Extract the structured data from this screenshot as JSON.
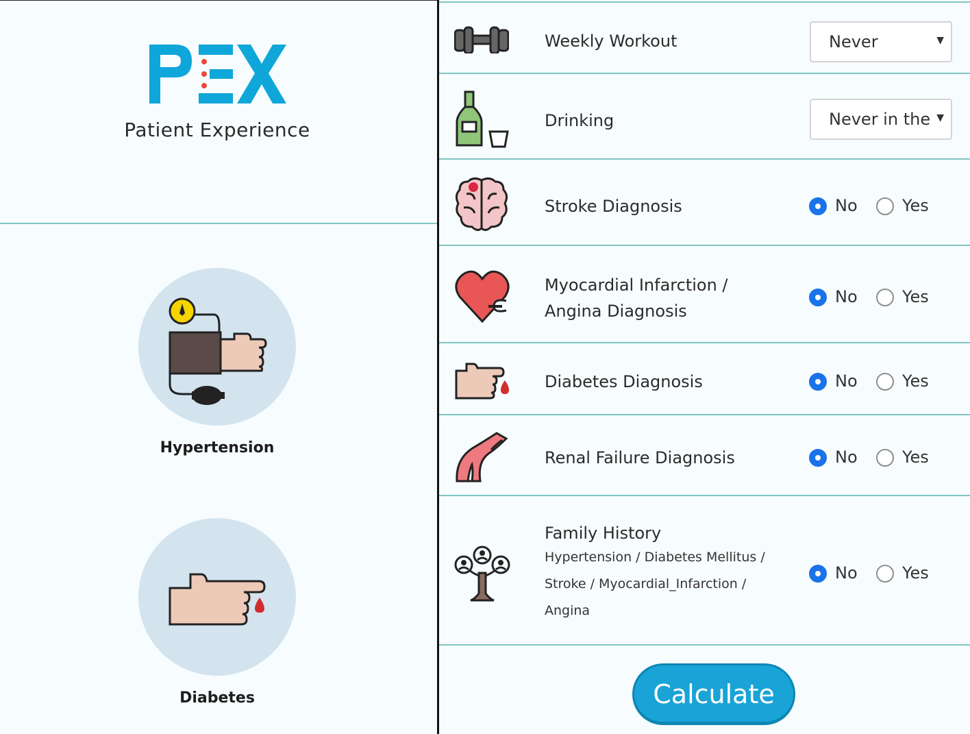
{
  "app": {
    "logo_text": "PEX",
    "tagline": "Patient Experience",
    "brand_color": "#0fa6d9",
    "accent_dot_color": "#e84b3a"
  },
  "diseases": [
    {
      "label": "Hypertension",
      "icon": "blood-pressure-cuff-icon"
    },
    {
      "label": "Diabetes",
      "icon": "finger-blood-drop-icon"
    }
  ],
  "form": {
    "weekly_workout": {
      "label": "Weekly Workout",
      "value": "Never",
      "icon": "dumbbell-icon"
    },
    "drinking": {
      "label": "Drinking",
      "value": "Never in the",
      "icon": "bottle-glass-icon"
    },
    "stroke": {
      "label": "Stroke Diagnosis",
      "selected": "No",
      "icon": "brain-icon"
    },
    "mi": {
      "label_line1": "Myocardial Infarction /",
      "label_line2": "Angina Diagnosis",
      "selected": "No",
      "icon": "broken-heart-icon"
    },
    "diabetes": {
      "label": "Diabetes Diagnosis",
      "selected": "No",
      "icon": "finger-drop-icon"
    },
    "renal": {
      "label": "Renal Failure Diagnosis",
      "selected": "No",
      "icon": "kidney-tube-icon"
    },
    "family": {
      "label": "Family History",
      "sub_line1": "Hypertension / Diabetes Mellitus /",
      "sub_line2": "Stroke / Myocardial_Infarction /",
      "sub_line3": "Angina",
      "selected": "No",
      "icon": "family-tree-icon"
    },
    "options": {
      "no": "No",
      "yes": "Yes"
    }
  },
  "calculate_label": "Calculate"
}
